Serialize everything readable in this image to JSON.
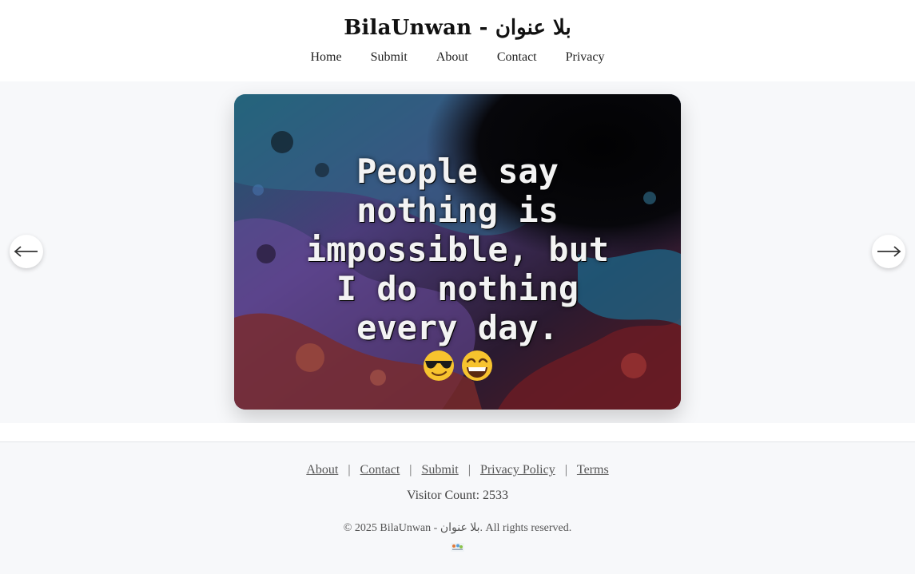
{
  "header": {
    "title": "BilaUnwan - بلا عنوان",
    "nav": [
      "Home",
      "Submit",
      "About",
      "Contact",
      "Privacy"
    ]
  },
  "slider": {
    "quote_lines": [
      "People say",
      "nothing is",
      "impossible, but",
      "I do nothing",
      "every day."
    ],
    "emojis": [
      "smiling-face-with-sunglasses",
      "grinning-face-with-smiling-eyes"
    ],
    "prev_icon": "arrow-left-icon",
    "next_icon": "arrow-right-icon"
  },
  "footer": {
    "links": [
      "About",
      "Contact",
      "Submit",
      "Privacy Policy",
      "Terms"
    ],
    "separator": "|",
    "visitor_count": "Visitor Count: 2533",
    "copyright": "© 2025 BilaUnwan - بلا عنوان. All rights reserved."
  },
  "colors": {
    "page_bg": "#f7f8fa",
    "header_bg": "#ffffff",
    "link": "#555555"
  }
}
